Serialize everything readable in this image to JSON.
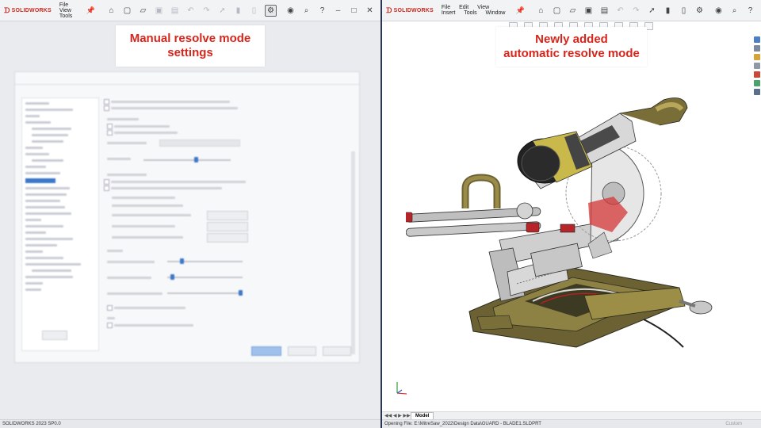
{
  "left": {
    "app_name": "SOLIDWORKS",
    "menu": [
      "File",
      "View",
      "Tools"
    ],
    "callout": [
      "Manual resolve mode",
      "settings"
    ],
    "status": "SOLIDWORKS 2023 SP0.0"
  },
  "right": {
    "app_name": "SOLIDWORKS",
    "menu": [
      "File",
      "Edit",
      "View",
      "Insert",
      "Tools",
      "Window"
    ],
    "callout": [
      "Newly added",
      "automatic resolve mode"
    ],
    "model_tab": "Model",
    "status": "Opening File: E:\\MitreSaw_2022\\Design Data\\GUARD - BLADE1.SLDPRT",
    "status_right": "Custom"
  },
  "icons": {
    "toolbar": [
      "home-icon",
      "new-doc-icon",
      "open-icon",
      "save-icon",
      "print-icon",
      "undo-icon",
      "redo-icon",
      "select-icon",
      "rebuild-icon",
      "options-icon",
      "account-icon",
      "search-icon",
      "help-icon",
      "minimize-icon",
      "maximize-icon",
      "close-icon"
    ]
  },
  "colors": {
    "callout_text": "#d8251c",
    "brand_red": "#d0271d",
    "saw_body": "#6b6132",
    "saw_metal": "#c9c9c9"
  }
}
